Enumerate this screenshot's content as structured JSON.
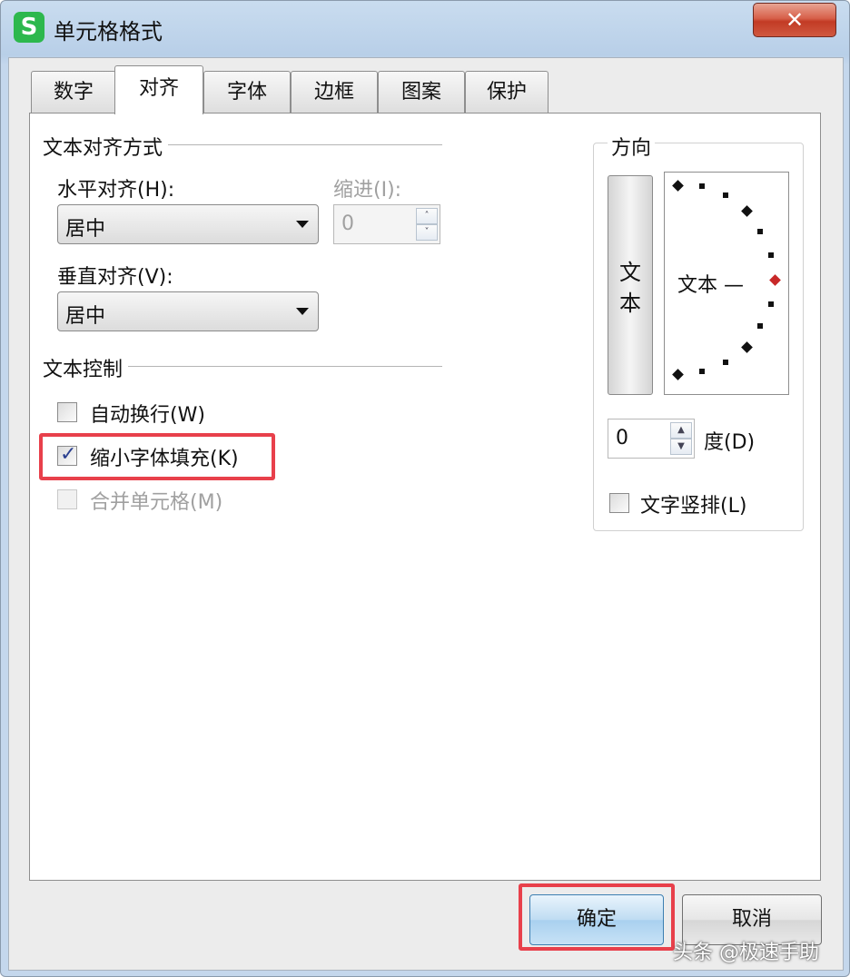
{
  "window": {
    "title": "单元格格式",
    "app_icon_glyph": "S",
    "close_glyph": "✕"
  },
  "tabs": [
    {
      "label": "数字",
      "active": false
    },
    {
      "label": "对齐",
      "active": true
    },
    {
      "label": "字体",
      "active": false
    },
    {
      "label": "边框",
      "active": false
    },
    {
      "label": "图案",
      "active": false
    },
    {
      "label": "保护",
      "active": false
    }
  ],
  "alignment": {
    "section_title": "文本对齐方式",
    "horizontal_label": "水平对齐(H):",
    "horizontal_value": "居中",
    "indent_label": "缩进(I):",
    "indent_value": "0",
    "vertical_label": "垂直对齐(V):",
    "vertical_value": "居中"
  },
  "text_control": {
    "section_title": "文本控制",
    "wrap_text": {
      "label": "自动换行(W)",
      "checked": false
    },
    "shrink_to_fit": {
      "label": "缩小字体填充(K)",
      "checked": true
    },
    "merge_cells": {
      "label": "合并单元格(M)",
      "checked": false,
      "disabled": true
    }
  },
  "orientation": {
    "title": "方向",
    "vertical_text_char1": "文",
    "vertical_text_char2": "本",
    "dial_label": "文本 —",
    "degree_value": "0",
    "degree_label": "度(D)",
    "vertical_layout_label": "文字竖排(L)"
  },
  "buttons": {
    "ok": "确定",
    "cancel": "取消"
  },
  "watermark": "头条 @极速手助",
  "colors": {
    "highlight": "#e8404b",
    "app_icon": "#2db84d",
    "close_button": "#c23b25"
  }
}
